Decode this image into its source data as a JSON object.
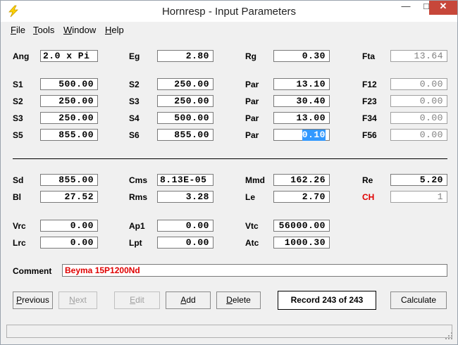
{
  "window": {
    "title": "Hornresp - Input Parameters"
  },
  "controls": {
    "minimize": "—",
    "maximize": "□",
    "close": "✕"
  },
  "menu": [
    {
      "ul": "F",
      "rest": "ile"
    },
    {
      "ul": "T",
      "rest": "ools"
    },
    {
      "ul": "W",
      "rest": "indow"
    },
    {
      "ul": "H",
      "rest": "elp"
    }
  ],
  "params": {
    "ang": {
      "label": "Ang",
      "value": "2.0 x Pi"
    },
    "eg": {
      "label": "Eg",
      "value": "2.80"
    },
    "rg": {
      "label": "Rg",
      "value": "0.30"
    },
    "fta": {
      "label": "Fta",
      "value": "13.64"
    },
    "s1": {
      "label": "S1",
      "value": "500.00"
    },
    "s2a": {
      "label": "S2",
      "value": "250.00"
    },
    "par1": {
      "label": "Par",
      "value": "13.10"
    },
    "f12": {
      "label": "F12",
      "value": "0.00"
    },
    "s2b": {
      "label": "S2",
      "value": "250.00"
    },
    "s3a": {
      "label": "S3",
      "value": "250.00"
    },
    "par2": {
      "label": "Par",
      "value": "30.40"
    },
    "f23": {
      "label": "F23",
      "value": "0.00"
    },
    "s3b": {
      "label": "S3",
      "value": "250.00"
    },
    "s4": {
      "label": "S4",
      "value": "500.00"
    },
    "par3": {
      "label": "Par",
      "value": "13.00"
    },
    "f34": {
      "label": "F34",
      "value": "0.00"
    },
    "s5": {
      "label": "S5",
      "value": "855.00"
    },
    "s6": {
      "label": "S6",
      "value": "855.00"
    },
    "par4": {
      "label": "Par",
      "value": "0.10"
    },
    "f56": {
      "label": "F56",
      "value": "0.00"
    },
    "sd": {
      "label": "Sd",
      "value": "855.00"
    },
    "cms": {
      "label": "Cms",
      "value": "8.13E-05"
    },
    "mmd": {
      "label": "Mmd",
      "value": "162.26"
    },
    "re": {
      "label": "Re",
      "value": "5.20"
    },
    "bl": {
      "label": "Bl",
      "value": "27.52"
    },
    "rms": {
      "label": "Rms",
      "value": "3.28"
    },
    "le": {
      "label": "Le",
      "value": "2.70"
    },
    "ch": {
      "label": "CH",
      "value": "1"
    },
    "vrc": {
      "label": "Vrc",
      "value": "0.00"
    },
    "ap1": {
      "label": "Ap1",
      "value": "0.00"
    },
    "vtc": {
      "label": "Vtc",
      "value": "56000.00"
    },
    "lrc": {
      "label": "Lrc",
      "value": "0.00"
    },
    "lpt": {
      "label": "Lpt",
      "value": "0.00"
    },
    "atc": {
      "label": "Atc",
      "value": "1000.30"
    }
  },
  "comment": {
    "label": "Comment",
    "value": "Beyma 15P1200Nd"
  },
  "buttons": {
    "previous": {
      "ul": "P",
      "rest": "revious"
    },
    "next": {
      "ul": "N",
      "rest": "ext"
    },
    "edit": {
      "ul": "E",
      "rest": "dit"
    },
    "add": {
      "ul": "A",
      "rest": "dd"
    },
    "delete": {
      "ul": "D",
      "rest": "elete"
    },
    "calculate": "Calculate"
  },
  "record": "Record 243 of 243",
  "colors": {
    "accent_red": "#e00000",
    "selection": "#3399ff",
    "close_button": "#c7473a"
  }
}
